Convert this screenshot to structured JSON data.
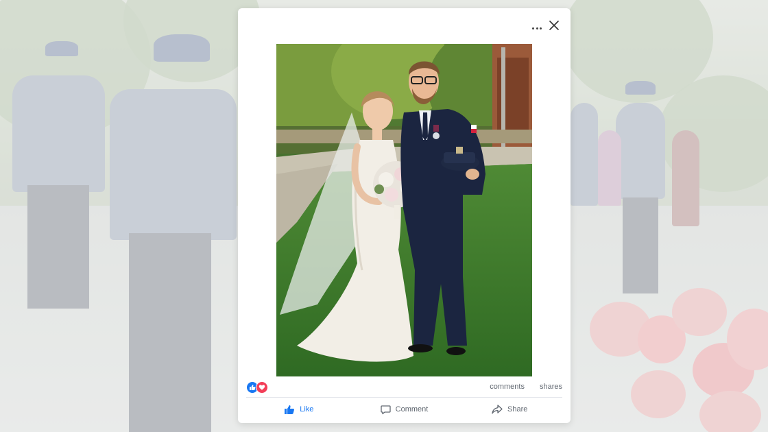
{
  "post": {
    "image_alt": "Wedding couple portrait — bride in lace gown and veil holding a bouquet, groom in navy police dress uniform holding his cap",
    "stats": {
      "comments_label": "comments",
      "shares_label": "shares"
    },
    "reactions": [
      "like-icon",
      "love-icon"
    ],
    "actions": [
      {
        "label": "Like",
        "icon": "thumbs-up-icon",
        "active": true
      },
      {
        "label": "Comment",
        "icon": "comment-icon",
        "active": false
      },
      {
        "label": "Share",
        "icon": "share-icon",
        "active": false
      }
    ]
  },
  "colors": {
    "accent": "#1877f2",
    "love": "#f33e58",
    "muted_text": "#606770"
  }
}
